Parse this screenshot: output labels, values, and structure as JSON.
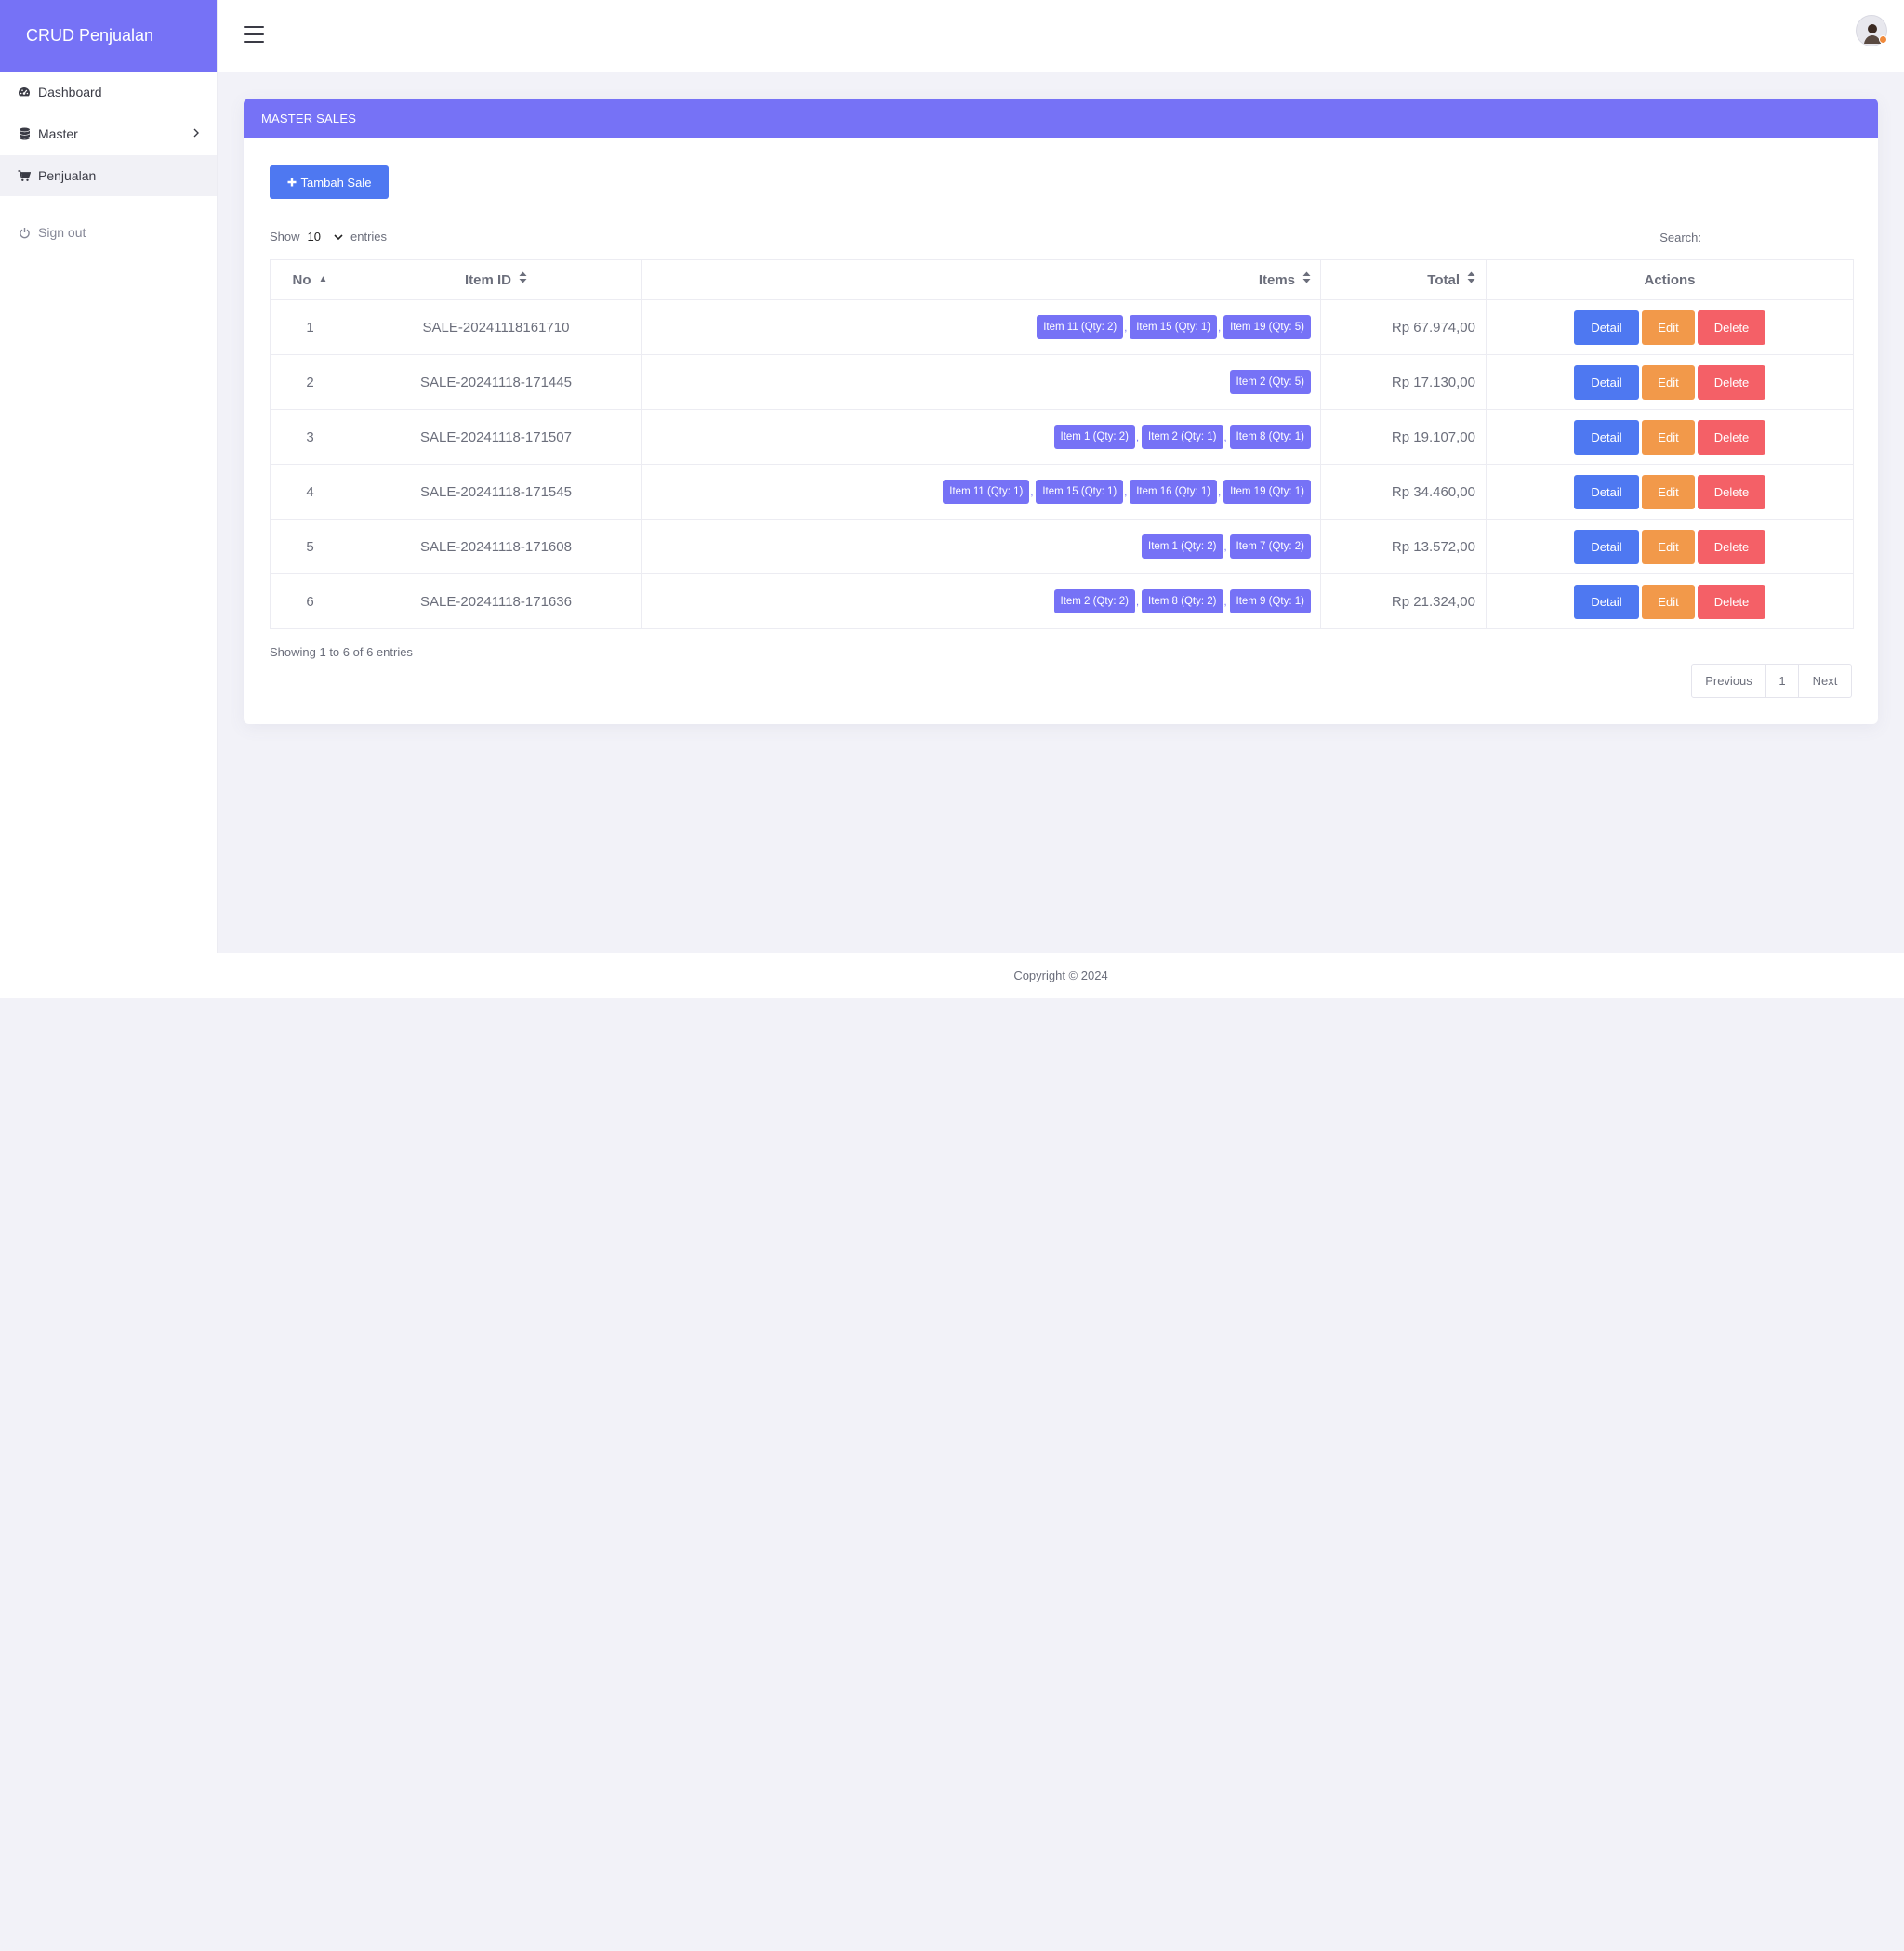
{
  "brand": "CRUD Penjualan",
  "nav": {
    "dashboard": "Dashboard",
    "master": "Master",
    "penjualan": "Penjualan",
    "signout": "Sign out"
  },
  "card": {
    "title": "MASTER SALES",
    "add_button": "Tambah Sale"
  },
  "table_controls": {
    "show_label": "Show",
    "entries_value": "10",
    "entries_label": "entries",
    "search_label": "Search:"
  },
  "columns": {
    "no": "No",
    "item_id": "Item ID",
    "items": "Items",
    "total": "Total",
    "actions": "Actions"
  },
  "rows": [
    {
      "no": "1",
      "item_id": "SALE-20241118161710",
      "items": [
        "Item 11 (Qty: 2)",
        "Item 15 (Qty: 1)",
        "Item 19 (Qty: 5)"
      ],
      "total": "Rp 67.974,00"
    },
    {
      "no": "2",
      "item_id": "SALE-20241118-171445",
      "items": [
        "Item 2 (Qty: 5)"
      ],
      "total": "Rp 17.130,00"
    },
    {
      "no": "3",
      "item_id": "SALE-20241118-171507",
      "items": [
        "Item 1 (Qty: 2)",
        "Item 2 (Qty: 1)",
        "Item 8 (Qty: 1)"
      ],
      "total": "Rp 19.107,00"
    },
    {
      "no": "4",
      "item_id": "SALE-20241118-171545",
      "items": [
        "Item 11 (Qty: 1)",
        "Item 15 (Qty: 1)",
        "Item 16 (Qty: 1)",
        "Item 19 (Qty: 1)"
      ],
      "total": "Rp 34.460,00"
    },
    {
      "no": "5",
      "item_id": "SALE-20241118-171608",
      "items": [
        "Item 1 (Qty: 2)",
        "Item 7 (Qty: 2)"
      ],
      "total": "Rp 13.572,00"
    },
    {
      "no": "6",
      "item_id": "SALE-20241118-171636",
      "items": [
        "Item 2 (Qty: 2)",
        "Item 8 (Qty: 2)",
        "Item 9 (Qty: 1)"
      ],
      "total": "Rp 21.324,00"
    }
  ],
  "actions": {
    "detail": "Detail",
    "edit": "Edit",
    "delete": "Delete"
  },
  "info": "Showing 1 to 6 of 6 entries",
  "pagination": {
    "previous": "Previous",
    "page": "1",
    "next": "Next"
  },
  "footer": "Copyright © 2024",
  "colors": {
    "primary": "#7672f6",
    "blue": "#4e78f1",
    "orange": "#f2994a",
    "red": "#f46067"
  },
  "icons": [
    "dashboard-icon",
    "database-icon",
    "chevron-right-icon",
    "cart-icon",
    "power-icon",
    "menu-icon",
    "plus-icon",
    "sort-icon",
    "chevron-down-icon"
  ]
}
